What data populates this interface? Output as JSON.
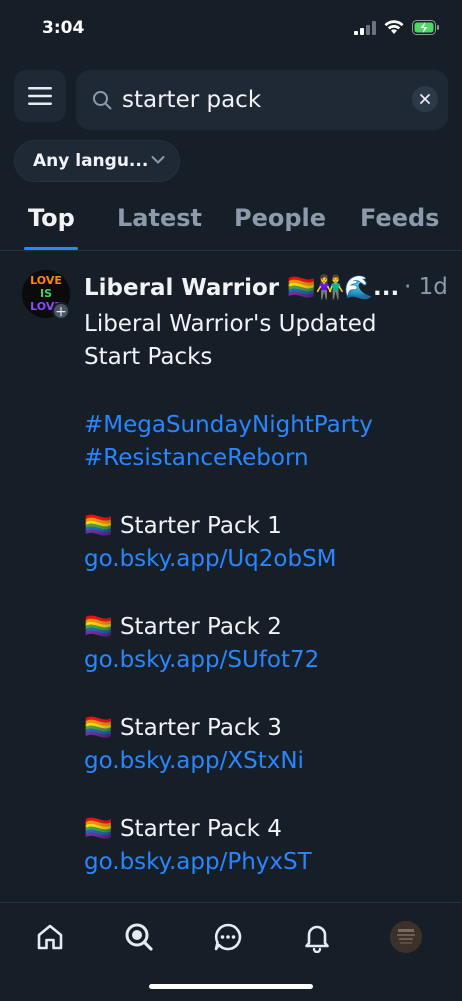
{
  "status": {
    "time": "3:04"
  },
  "search": {
    "value": "starter pack"
  },
  "filter": {
    "language": "Any langu..."
  },
  "tabs": [
    {
      "label": "Top",
      "active": true
    },
    {
      "label": "Latest",
      "active": false
    },
    {
      "label": "People",
      "active": false
    },
    {
      "label": "Feeds",
      "active": false
    }
  ],
  "post": {
    "author": "Liberal Warrior 🏳️‍🌈👫🌊...",
    "time": "· 1d",
    "avatar_text": [
      "LOVE",
      "IS",
      "LOVE"
    ],
    "title_lines": [
      "Liberal Warrior's Updated",
      "Start Packs"
    ],
    "hashtags": [
      "#MegaSundayNightParty",
      "#ResistanceReborn"
    ],
    "packs": [
      {
        "label": "🏳️‍🌈 Starter Pack 1",
        "link": "go.bsky.app/Uq2obSM"
      },
      {
        "label": "🏳️‍🌈 Starter Pack 2",
        "link": "go.bsky.app/SUfot72"
      },
      {
        "label": "🏳️‍🌈 Starter Pack 3",
        "link": "go.bsky.app/XStxNi"
      },
      {
        "label": "🏳️‍🌈 Starter Pack 4",
        "link": "go.bsky.app/PhyxST"
      }
    ]
  },
  "nav": [
    "home-icon",
    "search-icon",
    "chat-icon",
    "bell-icon",
    "profile-avatar"
  ],
  "colors": {
    "background": "#161e27",
    "link": "#2a86ff",
    "muted": "#8c9aab"
  }
}
